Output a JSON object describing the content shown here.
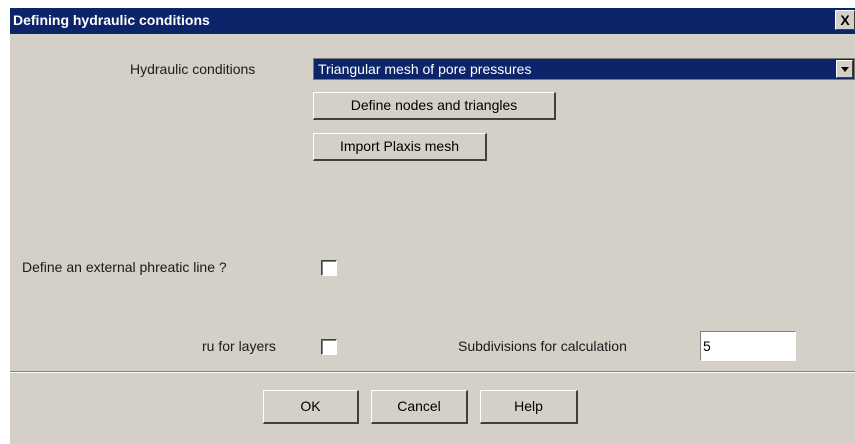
{
  "window": {
    "title": "Defining hydraulic conditions",
    "close_label": "X"
  },
  "form": {
    "hydraulic_label": "Hydraulic conditions",
    "hydraulic_value": "Triangular mesh of pore pressures",
    "define_nodes_button": "Define nodes and triangles",
    "import_plaxis_button": "Import Plaxis mesh",
    "phreatic_label": "Define an external phreatic line ?",
    "phreatic_checked": false,
    "ru_label": "ru for layers",
    "ru_checked": false,
    "subdivisions_label": "Subdivisions for calculation",
    "subdivisions_value": "5"
  },
  "footer": {
    "ok": "OK",
    "cancel": "Cancel",
    "help": "Help"
  },
  "colors": {
    "titlebar": "#0c246a",
    "dialog_bg": "#d4d0c8"
  }
}
